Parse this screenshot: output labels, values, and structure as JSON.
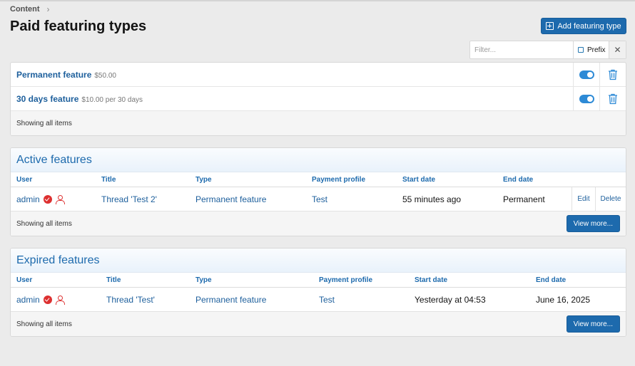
{
  "breadcrumb": {
    "label": "Content",
    "chevron": "›"
  },
  "page_title": "Paid featuring types",
  "add_button": {
    "label": "Add featuring type",
    "icon": "plus-square-icon"
  },
  "filter": {
    "placeholder": "Filter...",
    "value": "",
    "prefix_label": "Prefix",
    "prefix_checked": false,
    "clear_icon": "✕"
  },
  "featuring_types": {
    "items": [
      {
        "name": "Permanent feature",
        "meta": "$50.00",
        "enabled": true
      },
      {
        "name": "30 days feature",
        "meta": "$10.00 per 30 days",
        "enabled": true
      }
    ],
    "footer": "Showing all items"
  },
  "active": {
    "title": "Active features",
    "columns": [
      "User",
      "Title",
      "Type",
      "Payment profile",
      "Start date",
      "End date"
    ],
    "rows": [
      {
        "user": "admin",
        "title": "Thread 'Test 2'",
        "type": "Permanent feature",
        "profile": "Test",
        "start": "55 minutes ago",
        "end": "Permanent",
        "edit": "Edit",
        "delete": "Delete"
      }
    ],
    "footer": "Showing all items",
    "more": "View more..."
  },
  "expired": {
    "title": "Expired features",
    "columns": [
      "User",
      "Title",
      "Type",
      "Payment profile",
      "Start date",
      "End date"
    ],
    "rows": [
      {
        "user": "admin",
        "title": "Thread 'Test'",
        "type": "Permanent feature",
        "profile": "Test",
        "start": "Yesterday at 04:53",
        "end": "June 16, 2025"
      }
    ],
    "footer": "Showing all items",
    "more": "View more..."
  },
  "colors": {
    "primary": "#1d6aad",
    "link": "#1d5f9c",
    "danger": "#dd3030",
    "toggle_on": "#2d8ad6"
  }
}
